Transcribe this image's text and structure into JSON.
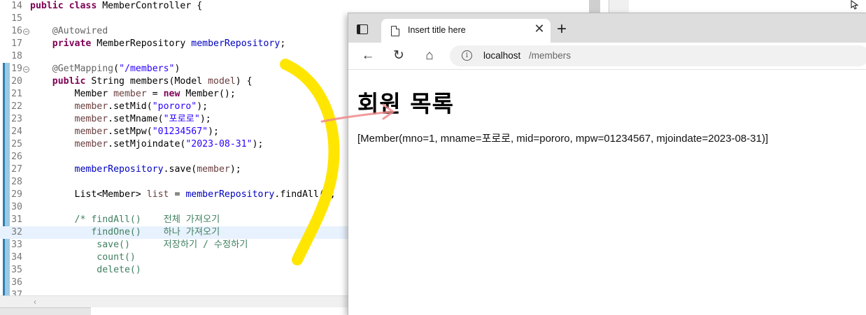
{
  "editor": {
    "lines": [
      {
        "num": "14",
        "tokens": [
          {
            "t": "public",
            "c": "kw"
          },
          {
            "t": " "
          },
          {
            "t": "class",
            "c": "kw"
          },
          {
            "t": " MemberController {"
          }
        ]
      },
      {
        "num": "15",
        "tokens": []
      },
      {
        "num": "16",
        "fold": true,
        "tokens": [
          {
            "t": "    "
          },
          {
            "t": "@Autowired",
            "c": "ann"
          }
        ]
      },
      {
        "num": "17",
        "tokens": [
          {
            "t": "    "
          },
          {
            "t": "private",
            "c": "kw"
          },
          {
            "t": " MemberRepository "
          },
          {
            "t": "memberRepository",
            "c": "fld"
          },
          {
            "t": ";"
          }
        ]
      },
      {
        "num": "18",
        "tokens": []
      },
      {
        "num": "19",
        "fold": true,
        "tokens": [
          {
            "t": "    "
          },
          {
            "t": "@GetMapping",
            "c": "ann"
          },
          {
            "t": "("
          },
          {
            "t": "\"/members\"",
            "c": "str"
          },
          {
            "t": ")"
          }
        ]
      },
      {
        "num": "20",
        "tokens": [
          {
            "t": "    "
          },
          {
            "t": "public",
            "c": "kw"
          },
          {
            "t": " String members(Model "
          },
          {
            "t": "model",
            "c": "loc"
          },
          {
            "t": ") {"
          }
        ]
      },
      {
        "num": "21",
        "tokens": [
          {
            "t": "        Member "
          },
          {
            "t": "member",
            "c": "loc"
          },
          {
            "t": " = "
          },
          {
            "t": "new",
            "c": "kw"
          },
          {
            "t": " Member();"
          }
        ]
      },
      {
        "num": "22",
        "tokens": [
          {
            "t": "        "
          },
          {
            "t": "member",
            "c": "loc"
          },
          {
            "t": ".setMid("
          },
          {
            "t": "\"pororo\"",
            "c": "str"
          },
          {
            "t": ");"
          }
        ]
      },
      {
        "num": "23",
        "tokens": [
          {
            "t": "        "
          },
          {
            "t": "member",
            "c": "loc"
          },
          {
            "t": ".setMname("
          },
          {
            "t": "\"포로로\"",
            "c": "str"
          },
          {
            "t": ");"
          }
        ]
      },
      {
        "num": "24",
        "tokens": [
          {
            "t": "        "
          },
          {
            "t": "member",
            "c": "loc"
          },
          {
            "t": ".setMpw("
          },
          {
            "t": "\"01234567\"",
            "c": "str"
          },
          {
            "t": ");"
          }
        ]
      },
      {
        "num": "25",
        "tokens": [
          {
            "t": "        "
          },
          {
            "t": "member",
            "c": "loc"
          },
          {
            "t": ".setMjoindate("
          },
          {
            "t": "\"2023-08-31\"",
            "c": "str"
          },
          {
            "t": ");"
          }
        ]
      },
      {
        "num": "26",
        "tokens": []
      },
      {
        "num": "27",
        "tokens": [
          {
            "t": "        "
          },
          {
            "t": "memberRepository",
            "c": "fld"
          },
          {
            "t": ".save("
          },
          {
            "t": "member",
            "c": "loc"
          },
          {
            "t": ");"
          }
        ]
      },
      {
        "num": "28",
        "tokens": []
      },
      {
        "num": "29",
        "tokens": [
          {
            "t": "        List<Member> "
          },
          {
            "t": "list",
            "c": "loc"
          },
          {
            "t": " = "
          },
          {
            "t": "memberRepository",
            "c": "fld"
          },
          {
            "t": ".findAll();"
          }
        ]
      },
      {
        "num": "30",
        "tokens": []
      },
      {
        "num": "31",
        "tokens": [
          {
            "t": "        "
          },
          {
            "t": "/* findAll()    전체 가져오기",
            "c": "cmt"
          }
        ]
      },
      {
        "num": "32",
        "current": true,
        "tokens": [
          {
            "t": "           "
          },
          {
            "t": "findOne()    하나 가져오기",
            "c": "cmt"
          }
        ]
      },
      {
        "num": "33",
        "tokens": [
          {
            "t": "            "
          },
          {
            "t": "save()      저장하기 / 수정하기",
            "c": "cmt"
          }
        ]
      },
      {
        "num": "34",
        "tokens": [
          {
            "t": "            "
          },
          {
            "t": "count()",
            "c": "cmt"
          }
        ]
      },
      {
        "num": "35",
        "tokens": [
          {
            "t": "            "
          },
          {
            "t": "delete()",
            "c": "cmt"
          }
        ]
      },
      {
        "num": "36",
        "tokens": []
      },
      {
        "num": "37",
        "tokens": []
      }
    ],
    "colors": {
      "keyword": "#7f0055",
      "string": "#2a00ff",
      "comment": "#3f7f5f",
      "field": "#0000c0",
      "annotation": "#646464",
      "current_line": "#e8f2fe"
    }
  },
  "browser": {
    "tab": {
      "title": "Insert title here",
      "icon": "page-icon",
      "close_glyph": "✕"
    },
    "new_tab_glyph": "+",
    "toolbar": {
      "back_glyph": "←",
      "reload_glyph": "↻",
      "home_glyph": "⌂"
    },
    "address": {
      "host": "localhost",
      "path": "/members",
      "info_glyph": "i"
    },
    "page": {
      "heading": "회원 목록",
      "text": "[Member(mno=1, mname=포로로, mid=pororo, mpw=01234567, mjoindate=2023-08-31)]"
    }
  },
  "annotations": {
    "bracket_color": "#ffe600",
    "arrow_color": "#f08a8a"
  }
}
